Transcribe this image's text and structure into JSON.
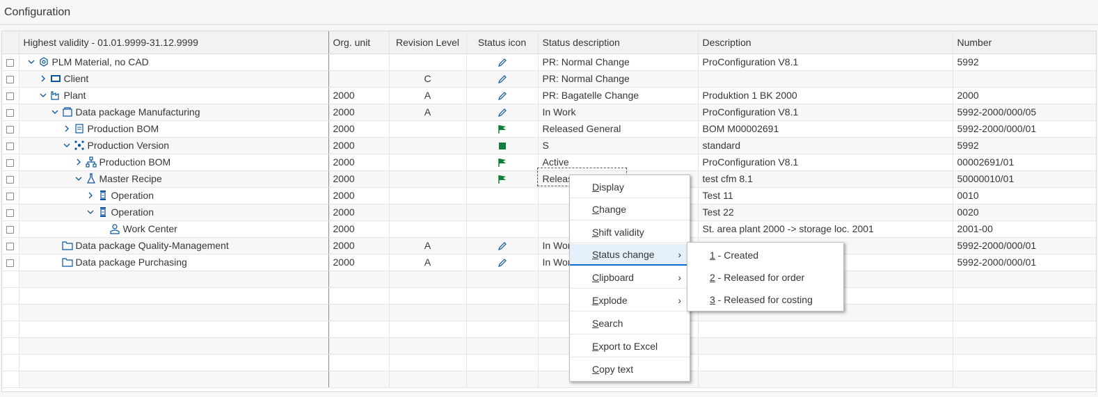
{
  "window": {
    "title": "Configuration"
  },
  "columns": {
    "hierarchy": "Highest validity - 01.01.9999-31.12.9999",
    "org_unit": "Org. unit",
    "revision": "Revision Level",
    "status_icon": "Status icon",
    "status_desc": "Status description",
    "description": "Description",
    "number": "Number"
  },
  "rows": [
    {
      "label": "PLM Material, no CAD",
      "org": "",
      "rev": "",
      "status_desc": "PR: Normal Change",
      "desc": "ProConfiguration V8.1",
      "number": "5992"
    },
    {
      "label": "Client",
      "org": "",
      "rev": "C",
      "status_desc": "PR: Normal Change",
      "desc": "",
      "number": ""
    },
    {
      "label": "Plant",
      "org": "2000",
      "rev": "A",
      "status_desc": "PR: Bagatelle Change",
      "desc": "Produktion 1 BK 2000",
      "number": "2000"
    },
    {
      "label": "Data package Manufacturing",
      "org": "2000",
      "rev": "A",
      "status_desc": "In Work",
      "desc": "ProConfiguration V8.1",
      "number": "5992-2000/000/05"
    },
    {
      "label": "Production BOM",
      "org": "2000",
      "rev": "",
      "status_desc": "Released General",
      "desc": "BOM M00002691",
      "number": "5992-2000/000/01"
    },
    {
      "label": "Production Version",
      "org": "2000",
      "rev": "",
      "status_desc": "S",
      "desc": "standard",
      "number": "5992"
    },
    {
      "label": "Production BOM",
      "org": "2000",
      "rev": "",
      "status_desc": "Active",
      "desc": "ProConfiguration V8.1",
      "number": "00002691/01"
    },
    {
      "label": "Master Recipe",
      "org": "2000",
      "rev": "",
      "status_desc": "Releas",
      "desc": "test cfm 8.1",
      "number": "50000010/01"
    },
    {
      "label": "Operation",
      "org": "2000",
      "rev": "",
      "status_desc": "",
      "desc": "Test 11",
      "number": "0010"
    },
    {
      "label": "Operation",
      "org": "2000",
      "rev": "",
      "status_desc": "",
      "desc": "Test 22",
      "number": "0020"
    },
    {
      "label": "Work Center",
      "org": "2000",
      "rev": "",
      "status_desc": "",
      "desc": "St. area plant 2000 -> storage loc. 2001",
      "number": "2001-00"
    },
    {
      "label": "Data package Quality-Management",
      "org": "2000",
      "rev": "A",
      "status_desc": "In Wor",
      "desc": "",
      "number": "5992-2000/000/01"
    },
    {
      "label": "Data package Purchasing",
      "org": "2000",
      "rev": "A",
      "status_desc": "In Wor",
      "desc": "",
      "number": "5992-2000/000/01"
    }
  ],
  "context_menu": {
    "items": [
      {
        "key": "D",
        "rest": "isplay"
      },
      {
        "key": "C",
        "rest": "hange"
      },
      {
        "key": "S",
        "rest": "hift validity"
      },
      {
        "key": "S",
        "rest": "tatus change"
      },
      {
        "key": "C",
        "rest": "lipboard"
      },
      {
        "key": "E",
        "rest": "xplode"
      },
      {
        "key": "S",
        "rest": "earch"
      },
      {
        "key": "E",
        "rest": "xport to Excel"
      },
      {
        "key": "C",
        "rest": "opy text"
      }
    ]
  },
  "submenu": {
    "items": [
      {
        "key": "1",
        "rest": " - Created"
      },
      {
        "key": "2",
        "rest": " - Released for order"
      },
      {
        "key": "3",
        "rest": " - Released for costing"
      }
    ]
  },
  "colors": {
    "accent": "#0a6ed1",
    "icon_blue": "#0854a0",
    "flag_green": "#107e3e"
  }
}
